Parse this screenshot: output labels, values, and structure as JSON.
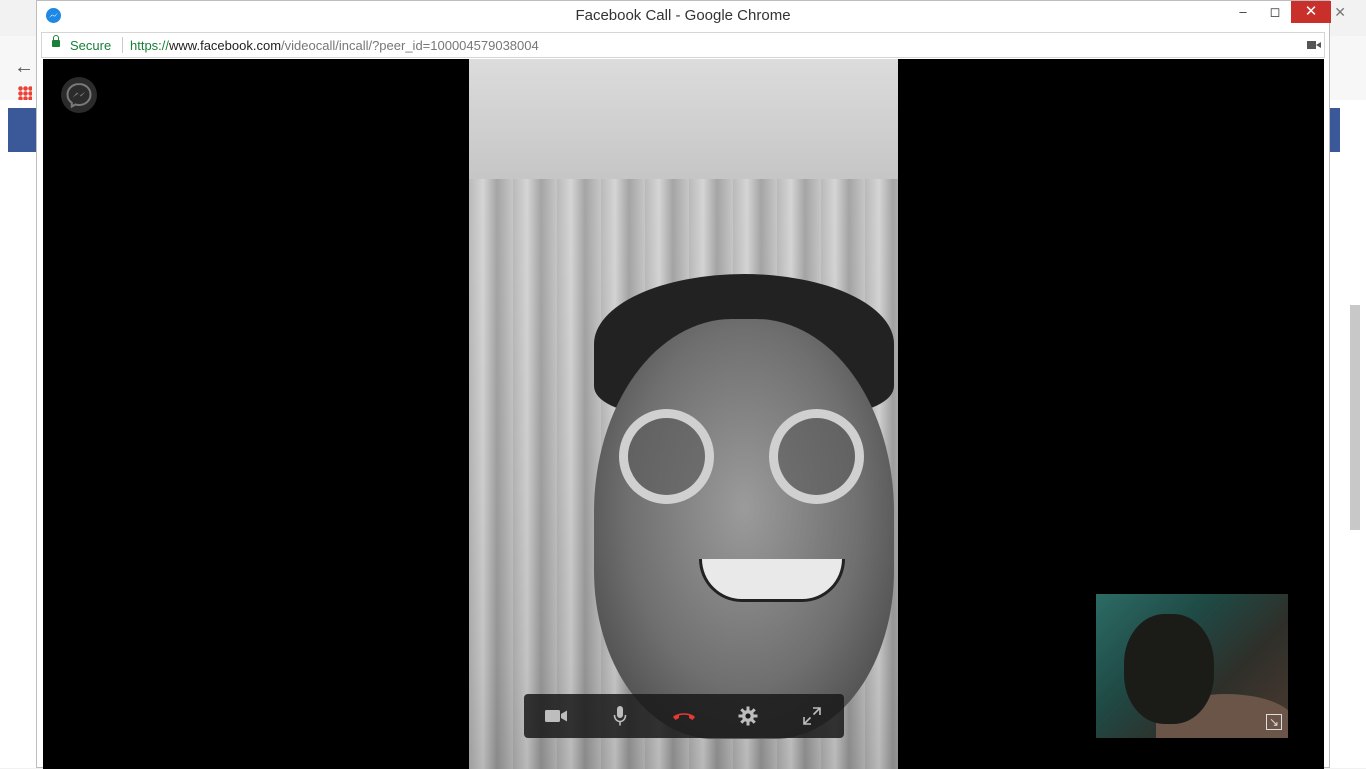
{
  "window": {
    "title": "Facebook Call - Google Chrome",
    "minimize_glyph": "–",
    "maximize_glyph": "◻",
    "close_glyph": "✕"
  },
  "addressbar": {
    "secure_label": "Secure",
    "url_protocol": "https://",
    "url_host": "www.facebook.com",
    "url_path": "/videocall/incall/?peer_id=100004579038004"
  },
  "call": {
    "controls": [
      {
        "name": "video-camera",
        "icon": "video-icon"
      },
      {
        "name": "microphone",
        "icon": "mic-icon"
      },
      {
        "name": "end-call",
        "icon": "phone-hangup-icon",
        "color": "#e53935"
      },
      {
        "name": "settings",
        "icon": "gear-icon"
      },
      {
        "name": "fullscreen",
        "icon": "expand-icon"
      }
    ],
    "self_view_expand_glyph": "↘"
  },
  "colors": {
    "secure_green": "#188038",
    "facebook_blue": "#3b5998",
    "close_red": "#c9302c",
    "end_call_red": "#e53935"
  }
}
